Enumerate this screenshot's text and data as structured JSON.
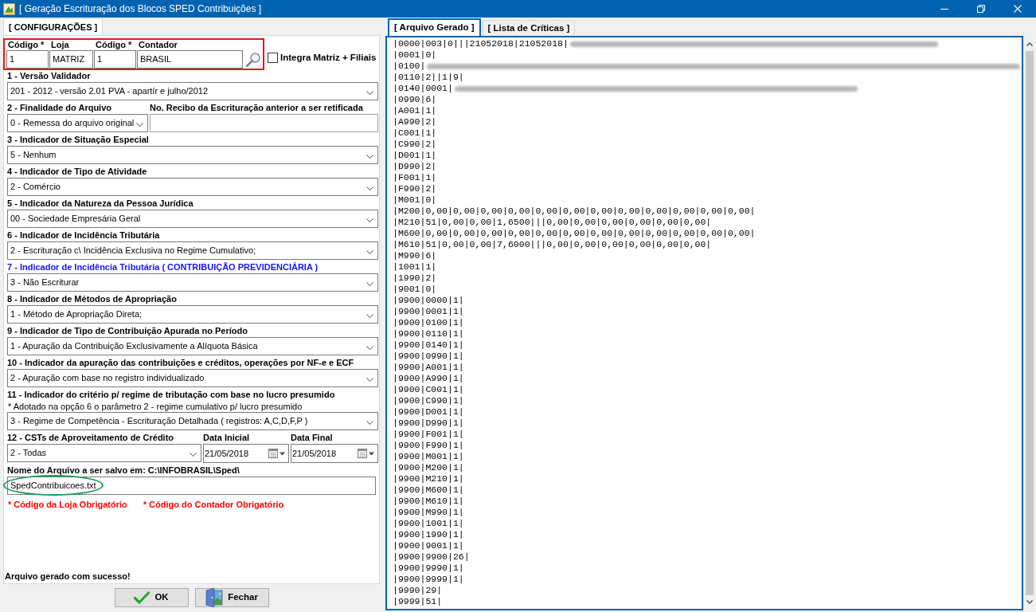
{
  "window": {
    "title": "[ Geração Escrituração dos Blocos SPED Contribuições ]"
  },
  "config_tabs": [
    {
      "label": "[ CONFIGURAÇÕES ]",
      "selected": true
    }
  ],
  "identification": {
    "annotated": true,
    "fields": [
      {
        "label": "Código *",
        "value": "1"
      },
      {
        "label": "Loja",
        "value": "MATRIZ"
      },
      {
        "label": "Código *",
        "value": "1"
      },
      {
        "label": "Contador",
        "value": "BRASIL"
      }
    ],
    "integra": {
      "label": "Integra Matriz + Filiais",
      "checked": false
    }
  },
  "sections": [
    {
      "kind": "select",
      "label": "1 - Versão Validador",
      "emphasized": false,
      "value": "201 - 2012 - versão 2.01 PVA - apartír e julho/2012"
    },
    {
      "kind": "select_input",
      "label": "2 - Finalidade do Arquivo",
      "emphasized": false,
      "value": "0 - Remessa do arquivo original",
      "input_label": "No. Recibo da Escrituração anterior a ser retificada"
    },
    {
      "kind": "select",
      "label": "3 - Indicador de Situação Especial",
      "emphasized": false,
      "value": "5 - Nenhum"
    },
    {
      "kind": "select",
      "label": "4 - Indicador de Tipo de Atividade",
      "emphasized": false,
      "value": "2 - Comércio"
    },
    {
      "kind": "select",
      "label": "5 - Indicador da Natureza da Pessoa Jurídica",
      "emphasized": false,
      "value": "00 - Sociedade Empresária Geral"
    },
    {
      "kind": "select",
      "label": "6 - Indicador de Incidência Tributária",
      "emphasized": false,
      "value": "2 - Escrituração c\\ Incidência Exclusiva no Regime Cumulativo;"
    },
    {
      "kind": "select",
      "label": "7 - Indicador de Incidência Tributária ( CONTRIBUIÇÃO PREVIDENCIÁRIA )",
      "emphasized": true,
      "value": "3 - Não Escriturar"
    },
    {
      "kind": "select",
      "label": "8 - Indicador de Métodos de Apropriação",
      "emphasized": false,
      "value": "1 - Método de Apropriação Direta;"
    },
    {
      "kind": "select",
      "label": "9 - Indicador de Tipo de Contribuição Apurada no Período",
      "emphasized": false,
      "value": "1 - Apuração da Contribuição Exclusivamente a Alíquota Básica"
    },
    {
      "kind": "select",
      "label": "10 - Indicador da apuração das contribuições e créditos, operações por NF-e e ECF",
      "emphasized": false,
      "value": "2 - Apuração com base no registro individualizado"
    },
    {
      "kind": "select",
      "label": "11 - Indicador do critério p/ regime de tributação com base no lucro presumido",
      "emphasized": false,
      "note": "* Adotado na opção 6 o parâmetro 2 - regime cumulativo p/ lucro presumido",
      "value": "3 - Regime de Competência - Escrituração Detalhada ( registros: A,C,D,F,P )"
    },
    {
      "kind": "select_dates",
      "label": "12 - CSTs de Aproveitamento de Crédito",
      "emphasized": false,
      "value": "2 - Todas",
      "dates": [
        {
          "label": "Data Inicial",
          "value": "21/05/2018"
        },
        {
          "label": "Data Final",
          "value": "21/05/2018"
        }
      ]
    },
    {
      "kind": "file",
      "label": "Nome do Arquivo a ser salvo em: C:\\INFOBRASIL\\Sped\\",
      "emphasized": false,
      "value": "SpedContribuicoes.txt",
      "annotated": true
    }
  ],
  "errors": [
    "* Código da Loja Obrigatório",
    "* Código do Contador Obrigatório"
  ],
  "status": "Arquivo gerado com sucesso!",
  "buttons": [
    {
      "kind": "ok",
      "label": "OK"
    },
    {
      "kind": "close",
      "label": "Fechar"
    }
  ],
  "output_tabs": [
    {
      "label": "[ Arquivo Gerado ]",
      "selected": true
    },
    {
      "label": "[ Lista de Críticas ]",
      "selected": false
    }
  ],
  "file_lines": [
    {
      "text": "|0000|003|0|||21052018|21052018|",
      "redacted": true
    },
    {
      "text": "|0001|0|",
      "redacted": false
    },
    {
      "text": "|0100|",
      "redacted": true
    },
    {
      "text": "|0110|2||1|9|",
      "redacted": false
    },
    {
      "text": "|0140|0001|",
      "redacted": true
    },
    {
      "text": "|0990|6|",
      "redacted": false
    },
    {
      "text": "|A001|1|",
      "redacted": false
    },
    {
      "text": "|A990|2|",
      "redacted": false
    },
    {
      "text": "|C001|1|",
      "redacted": false
    },
    {
      "text": "|C990|2|",
      "redacted": false
    },
    {
      "text": "|D001|1|",
      "redacted": false
    },
    {
      "text": "|D990|2|",
      "redacted": false
    },
    {
      "text": "|F001|1|",
      "redacted": false
    },
    {
      "text": "|F990|2|",
      "redacted": false
    },
    {
      "text": "|M001|0|",
      "redacted": false
    },
    {
      "text": "|M200|0,00|0,00|0,00|0,00|0,00|0,00|0,00|0,00|0,00|0,00|0,00|0,00|",
      "redacted": false
    },
    {
      "text": "|M210|51|0,00|0,00|1,6500|||0,00|0,00|0,00|0,00|0,00|0,00|",
      "redacted": false
    },
    {
      "text": "|M600|0,00|0,00|0,00|0,00|0,00|0,00|0,00|0,00|0,00|0,00|0,00|0,00|",
      "redacted": false
    },
    {
      "text": "|M610|51|0,00|0,00|7,6000|||0,00|0,00|0,00|0,00|0,00|0,00|",
      "redacted": false
    },
    {
      "text": "|M990|6|",
      "redacted": false
    },
    {
      "text": "|1001|1|",
      "redacted": false
    },
    {
      "text": "|1990|2|",
      "redacted": false
    },
    {
      "text": "|9001|0|",
      "redacted": false
    },
    {
      "text": "|9900|0000|1|",
      "redacted": false
    },
    {
      "text": "|9900|0001|1|",
      "redacted": false
    },
    {
      "text": "|9900|0100|1|",
      "redacted": false
    },
    {
      "text": "|9900|0110|1|",
      "redacted": false
    },
    {
      "text": "|9900|0140|1|",
      "redacted": false
    },
    {
      "text": "|9900|0990|1|",
      "redacted": false
    },
    {
      "text": "|9900|A001|1|",
      "redacted": false
    },
    {
      "text": "|9900|A990|1|",
      "redacted": false
    },
    {
      "text": "|9900|C001|1|",
      "redacted": false
    },
    {
      "text": "|9900|C990|1|",
      "redacted": false
    },
    {
      "text": "|9900|D001|1|",
      "redacted": false
    },
    {
      "text": "|9900|D990|1|",
      "redacted": false
    },
    {
      "text": "|9900|F001|1|",
      "redacted": false
    },
    {
      "text": "|9900|F990|1|",
      "redacted": false
    },
    {
      "text": "|9900|M001|1|",
      "redacted": false
    },
    {
      "text": "|9900|M200|1|",
      "redacted": false
    },
    {
      "text": "|9900|M210|1|",
      "redacted": false
    },
    {
      "text": "|9900|M600|1|",
      "redacted": false
    },
    {
      "text": "|9900|M610|1|",
      "redacted": false
    },
    {
      "text": "|9900|M990|1|",
      "redacted": false
    },
    {
      "text": "|9900|1001|1|",
      "redacted": false
    },
    {
      "text": "|9900|1990|1|",
      "redacted": false
    },
    {
      "text": "|9900|9001|1|",
      "redacted": false
    },
    {
      "text": "|9900|9900|26|",
      "redacted": false
    },
    {
      "text": "|9900|9990|1|",
      "redacted": false
    },
    {
      "text": "|9900|9999|1|",
      "redacted": false
    },
    {
      "text": "|9990|29|",
      "redacted": false
    },
    {
      "text": "|9999|51|",
      "redacted": false
    }
  ]
}
